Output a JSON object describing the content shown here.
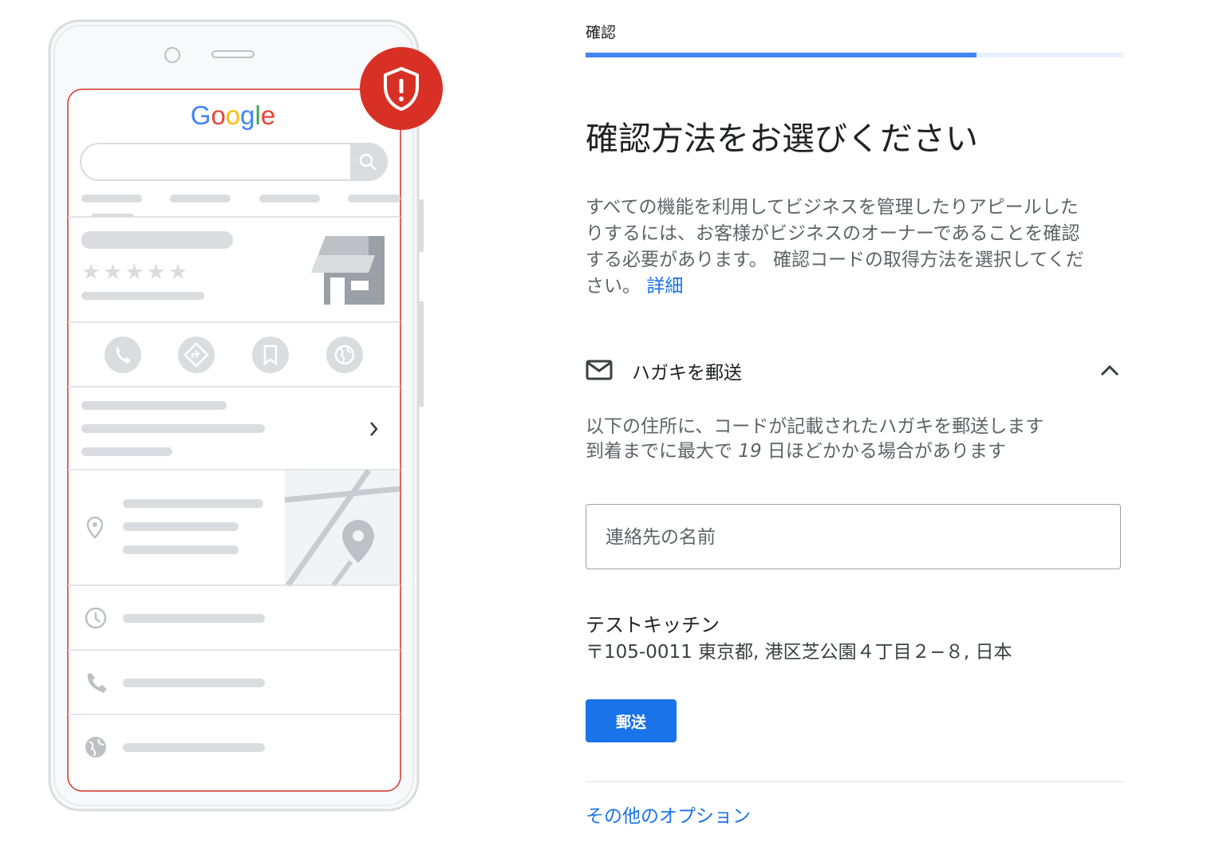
{
  "illustration": {
    "logo_text": "Google",
    "stars": "★★★★★"
  },
  "step": {
    "label": "確認",
    "progress_fraction": 0.727
  },
  "page": {
    "title": "確認方法をお選びください",
    "description_lines": [
      "すべての機能を利用してビジネスを管理したりアピールした",
      "りするには、お客様がビジネスのオーナーであることを確認",
      "する必要があります。 確認コードの取得方法を選択してくだ",
      "さい。"
    ],
    "details_link": "詳細"
  },
  "method": {
    "label": "ハガキを郵送",
    "info_line1": "以下の住所に、コードが記載されたハガキを郵送します",
    "info_line2_prefix": "到着までに最大で ",
    "info_days": "19",
    "info_line2_suffix": " 日ほどかかる場合があります",
    "contact_placeholder": "連絡先の名前",
    "business_name": "テストキッチン",
    "business_address": "〒105-0011 東京都, 港区芝公園４丁目２−８, 日本",
    "send_label": "郵送"
  },
  "footer": {
    "other_options": "その他のオプション"
  },
  "colors": {
    "accent": "#1a73e8",
    "progress": "#4285f4",
    "shield": "#d93025"
  }
}
